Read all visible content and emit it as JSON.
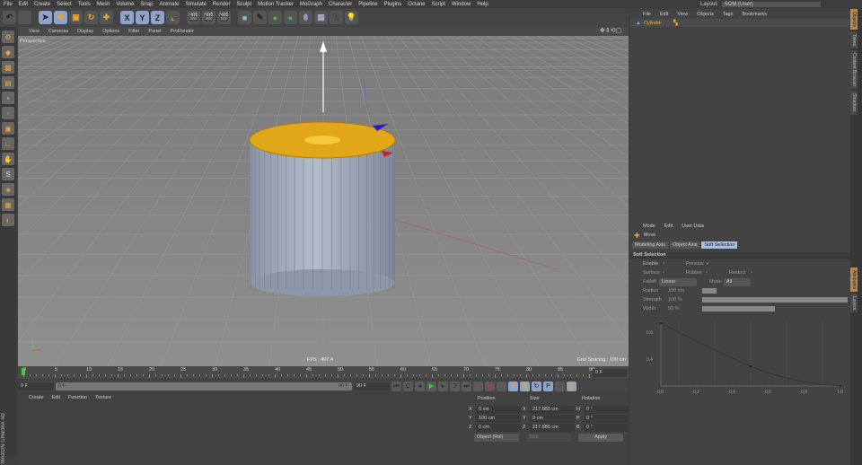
{
  "menu": [
    "File",
    "Edit",
    "Create",
    "Select",
    "Tools",
    "Mesh",
    "Volume",
    "Snap",
    "Animate",
    "Simulate",
    "Render",
    "Sculpt",
    "Motion Tracker",
    "MoGraph",
    "Character",
    "Pipeline",
    "Plugins",
    "Octane",
    "Script",
    "Window",
    "Help"
  ],
  "layout": {
    "label": "Layout:",
    "value": "SOM (User)"
  },
  "toolbar": {
    "x": "X",
    "y": "Y",
    "z": "Z"
  },
  "viewport": {
    "menu": [
      "View",
      "Cameras",
      "Display",
      "Options",
      "Filter",
      "Panel",
      "ProRender"
    ],
    "label": "Perspective",
    "fps": "FPS : 407.4",
    "grid_spacing": "Grid Spacing : 100 cm"
  },
  "timeline": {
    "ticks": [
      "0",
      "5",
      "10",
      "15",
      "20",
      "25",
      "30",
      "35",
      "40",
      "45",
      "50",
      "55",
      "60",
      "65",
      "70",
      "75",
      "80",
      "85",
      "90"
    ],
    "current": "0 F"
  },
  "controls": {
    "start": "0 F",
    "range_start": "0 F",
    "range_end": "90 F",
    "end": "90 F"
  },
  "material_manager": {
    "menu": [
      "Create",
      "Edit",
      "Function",
      "Texture"
    ]
  },
  "coords": {
    "headers": [
      "Position",
      "Size",
      "Rotation"
    ],
    "rows": [
      {
        "a": "X",
        "p": "0 cm",
        "b": "X",
        "s": "217.885 cm",
        "c": "H",
        "r": "0 °"
      },
      {
        "a": "Y",
        "p": "100 cm",
        "b": "Y",
        "s": "0 cm",
        "c": "P",
        "r": "0 °"
      },
      {
        "a": "Z",
        "p": "0 cm",
        "b": "Z",
        "s": "217.885 cm",
        "c": "B",
        "r": "0 °"
      }
    ],
    "mode": "Object (Rel)",
    "size_mode": "Size",
    "apply": "Apply"
  },
  "objects": {
    "menu": [
      "File",
      "Edit",
      "View",
      "Objects",
      "Tags",
      "Bookmarks"
    ],
    "items": [
      {
        "name": "Cylinder"
      }
    ]
  },
  "attributes": {
    "menu": [
      "Mode",
      "Edit",
      "User Data"
    ],
    "tool": "Move",
    "tabs": [
      "Modeling Axis",
      "Object Axis",
      "Soft Selection"
    ],
    "active_tab": 2,
    "section": "Soft Selection",
    "enable": "Enable",
    "preview": "Preview",
    "surface": "Surface",
    "rubber": "Rubber",
    "restrict": "Restrict",
    "falloff": "Falloff",
    "falloff_value": "Linear",
    "mode": "Mode",
    "mode_value": "All",
    "radius": "Radius",
    "radius_value": "100 cm",
    "strength": "Strength",
    "strength_value": "100 %",
    "strength_frac": 1.0,
    "width": "Width",
    "width_value": "50 %",
    "width_frac": 0.5,
    "graph_y": [
      "0.8",
      "0.4"
    ],
    "graph_x": [
      "0.0",
      "0.2",
      "0.4",
      "0.6",
      "0.8",
      "1.0"
    ]
  },
  "right_tabs": [
    "Objects",
    "Takes",
    "Content Browser",
    "Structure"
  ],
  "right_tabs2": [
    "Attributes",
    "Layers"
  ],
  "brand": [
    "MAXON",
    "CINEMA 4D"
  ]
}
